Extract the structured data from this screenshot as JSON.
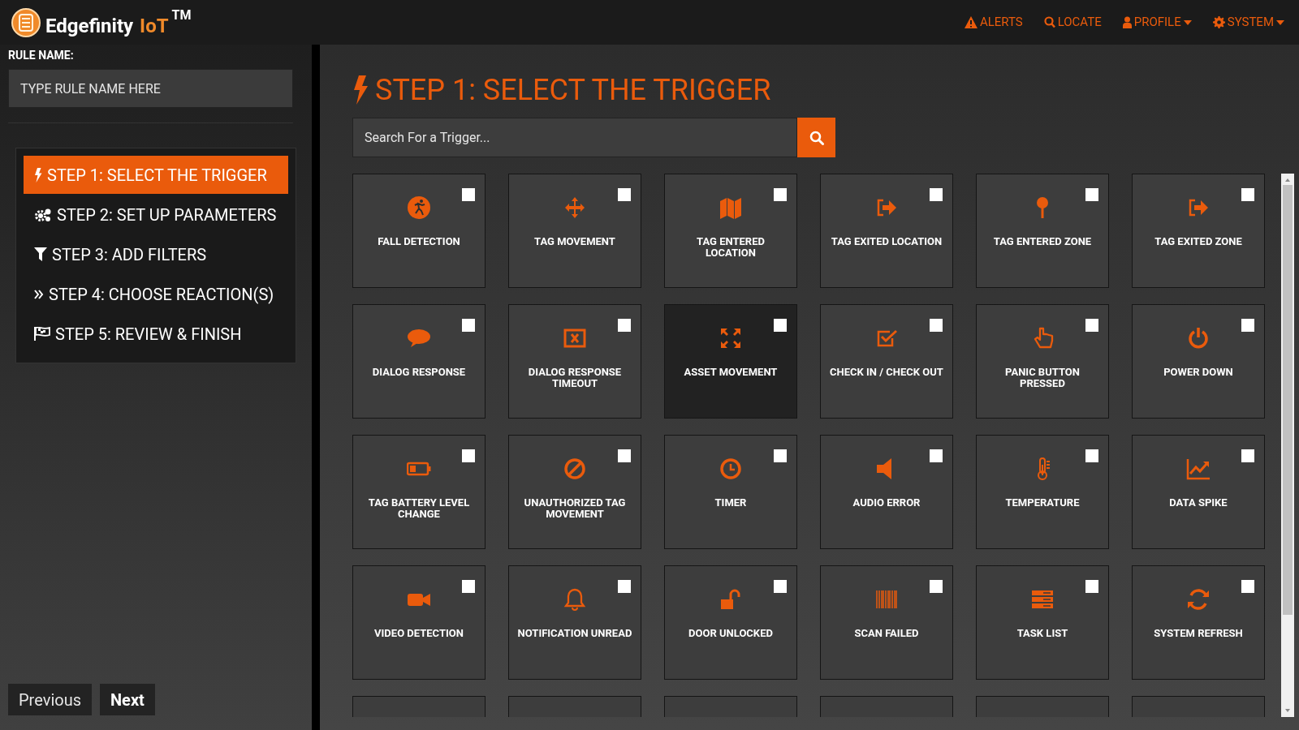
{
  "header": {
    "brand": {
      "name": "Edgefinity",
      "suffix": "IoT",
      "mark": "TM"
    },
    "nav": [
      {
        "label": "ALERTS",
        "dropdown": false
      },
      {
        "label": "LOCATE",
        "dropdown": false
      },
      {
        "label": "PROFILE",
        "dropdown": true
      },
      {
        "label": "SYSTEM",
        "dropdown": true
      }
    ]
  },
  "sidebar": {
    "rule_name": {
      "label": "RULE NAME:",
      "placeholder": "TYPE RULE NAME HERE"
    },
    "steps": [
      {
        "label": "STEP 1: SELECT THE TRIGGER",
        "selected": true
      },
      {
        "label": "STEP 2: SET UP PARAMETERS",
        "selected": false
      },
      {
        "label": "STEP 3: ADD FILTERS",
        "selected": false
      },
      {
        "label": "STEP 4: CHOOSE REACTION(S)",
        "selected": false
      },
      {
        "label": "STEP 5: REVIEW & FINISH",
        "selected": false
      }
    ],
    "buttons": [
      "Previous",
      "Next"
    ]
  },
  "main": {
    "title": "STEP 1: SELECT THE TRIGGER",
    "search": {
      "placeholder": "Search For a Trigger..."
    },
    "triggers": [
      {
        "label": "FALL DETECTION",
        "selected": false,
        "checked": false
      },
      {
        "label": "TAG MOVEMENT",
        "selected": false,
        "checked": false
      },
      {
        "label": "TAG ENTERED LOCATION",
        "selected": false,
        "checked": false
      },
      {
        "label": "TAG EXITED LOCATION",
        "selected": false,
        "checked": false
      },
      {
        "label": "TAG ENTERED ZONE",
        "selected": false,
        "checked": false
      },
      {
        "label": "TAG EXITED ZONE",
        "selected": false,
        "checked": false
      },
      {
        "label": "DIALOG RESPONSE",
        "selected": false,
        "checked": false
      },
      {
        "label": "DIALOG RESPONSE TIMEOUT",
        "selected": false,
        "checked": false
      },
      {
        "label": "ASSET MOVEMENT",
        "selected": true,
        "checked": false
      },
      {
        "label": "CHECK IN / CHECK OUT",
        "selected": false,
        "checked": false
      },
      {
        "label": "PANIC BUTTON PRESSED",
        "selected": false,
        "checked": false
      },
      {
        "label": "POWER DOWN",
        "selected": false,
        "checked": false
      },
      {
        "label": "TAG BATTERY LEVEL CHANGE",
        "selected": false,
        "checked": false
      },
      {
        "label": "UNAUTHORIZED TAG MOVEMENT",
        "selected": false,
        "checked": false
      },
      {
        "label": "TIMER",
        "selected": false,
        "checked": false
      },
      {
        "label": "AUDIO ERROR",
        "selected": false,
        "checked": false
      },
      {
        "label": "TEMPERATURE",
        "selected": false,
        "checked": false
      },
      {
        "label": "DATA SPIKE",
        "selected": false,
        "checked": false
      },
      {
        "label": "VIDEO DETECTION",
        "selected": false,
        "checked": false
      },
      {
        "label": "NOTIFICATION UNREAD",
        "selected": false,
        "checked": false
      },
      {
        "label": "DOOR UNLOCKED",
        "selected": false,
        "checked": false
      },
      {
        "label": "SCAN FAILED",
        "selected": false,
        "checked": false
      },
      {
        "label": "TASK LIST",
        "selected": false,
        "checked": false
      },
      {
        "label": "SYSTEM REFRESH",
        "selected": false,
        "checked": false
      },
      {
        "selected": false
      },
      {
        "selected": false
      },
      {
        "selected": false
      },
      {
        "selected": false
      },
      {
        "selected": false
      },
      {
        "selected": false
      }
    ]
  }
}
